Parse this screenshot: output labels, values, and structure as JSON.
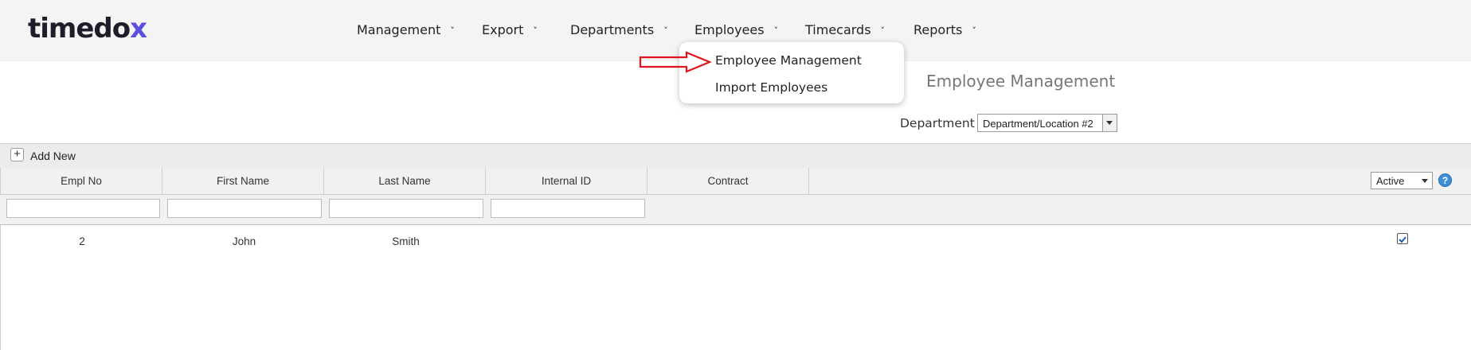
{
  "app": {
    "logo_main": "timedo",
    "logo_accent": "x"
  },
  "nav": {
    "items": [
      {
        "label": "Management"
      },
      {
        "label": "Export"
      },
      {
        "label": "Departments"
      },
      {
        "label": "Employees"
      },
      {
        "label": "Timecards"
      },
      {
        "label": "Reports"
      }
    ],
    "employees_menu": [
      "Employee Management",
      "Import Employees"
    ]
  },
  "page": {
    "title": "Employee Management",
    "department_label": "Department",
    "department_value": "Department/Location #2"
  },
  "toolbar": {
    "add_new": "Add New",
    "add_icon": "+"
  },
  "grid": {
    "columns": [
      "Empl No",
      "First Name",
      "Last Name",
      "Internal ID",
      "Contract"
    ],
    "status_filter": "Active",
    "help_icon": "?",
    "rows": [
      {
        "empl_no": "2",
        "first_name": "John",
        "last_name": "Smith",
        "internal_id": "",
        "contract": "",
        "active": true
      }
    ]
  },
  "colors": {
    "accent": "#5a4fe0",
    "arrow": "#e0141e",
    "help": "#3b8fd8"
  }
}
